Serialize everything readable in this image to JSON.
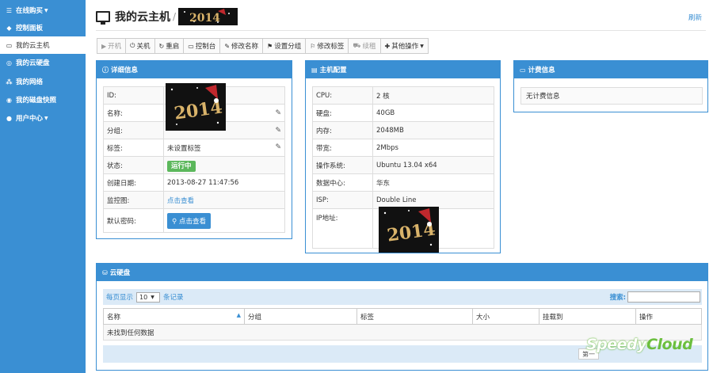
{
  "sidebar": {
    "items": [
      {
        "icon": "cart-icon",
        "glyph": "☰",
        "label": "在线购买",
        "dropdown": true
      },
      {
        "icon": "dashboard-icon",
        "glyph": "◆",
        "label": "控制面板"
      },
      {
        "icon": "monitor-icon",
        "glyph": "▭",
        "label": "我的云主机",
        "active": true
      },
      {
        "icon": "disk-icon",
        "glyph": "◎",
        "label": "我的云硬盘"
      },
      {
        "icon": "network-icon",
        "glyph": "⁂",
        "label": "我的网络"
      },
      {
        "icon": "snapshot-icon",
        "glyph": "◉",
        "label": "我的磁盘快照"
      },
      {
        "icon": "user-icon",
        "glyph": "●",
        "label": "用户中心",
        "dropdown": true
      }
    ]
  },
  "header": {
    "title": "我的云主机",
    "refresh_label": "刷新"
  },
  "toolbar": {
    "buttons": [
      {
        "icon": "play-icon",
        "glyph": "▶",
        "label": "开机",
        "disabled": true
      },
      {
        "icon": "power-icon",
        "glyph": "⏻",
        "label": "关机"
      },
      {
        "icon": "restart-icon",
        "glyph": "↻",
        "label": "重启"
      },
      {
        "icon": "console-icon",
        "glyph": "▭",
        "label": "控制台"
      },
      {
        "icon": "edit-icon",
        "glyph": "✎",
        "label": "修改名称"
      },
      {
        "icon": "group-icon",
        "glyph": "⚑",
        "label": "设置分组"
      },
      {
        "icon": "tag-icon",
        "glyph": "⚐",
        "label": "修改标签"
      },
      {
        "icon": "cart-icon",
        "glyph": "⛟",
        "label": "续租",
        "disabled": true
      },
      {
        "icon": "wrench-icon",
        "glyph": "✚",
        "label": "其他操作",
        "dropdown": true
      }
    ]
  },
  "detail_panel": {
    "title": "详细信息",
    "rows": [
      {
        "key": "ID:",
        "value": ""
      },
      {
        "key": "名称:",
        "value": "",
        "editable": true
      },
      {
        "key": "分组:",
        "value": "",
        "editable": true
      },
      {
        "key": "标签:",
        "value": "未设置标签",
        "editable": true
      },
      {
        "key": "状态:",
        "value": "运行中",
        "type": "badge"
      },
      {
        "key": "创建日期:",
        "value": "2013-08-27 11:47:56"
      },
      {
        "key": "监控图:",
        "value": "点击查看",
        "type": "link"
      },
      {
        "key": "默认密码:",
        "value": "点击查看",
        "type": "button"
      }
    ]
  },
  "config_panel": {
    "title": "主机配置",
    "rows": [
      {
        "key": "CPU:",
        "value": "2 核"
      },
      {
        "key": "硬盘:",
        "value": "40GB"
      },
      {
        "key": "内存:",
        "value": "2048MB"
      },
      {
        "key": "带宽:",
        "value": "2Mbps"
      },
      {
        "key": "操作系统:",
        "value": "Ubuntu 13.04 x64"
      },
      {
        "key": "数据中心:",
        "value": "华东"
      },
      {
        "key": "ISP:",
        "value": "Double Line"
      },
      {
        "key": "IP地址:",
        "value": ""
      }
    ]
  },
  "billing_panel": {
    "title": "计费信息",
    "empty_text": "无计费信息"
  },
  "disk_panel": {
    "title": "云硬盘",
    "per_page_prefix": "每页显示",
    "per_page_value": "10",
    "per_page_suffix": "条记录",
    "search_label": "搜索:",
    "columns": [
      "名称",
      "分组",
      "标签",
      "大小",
      "挂载到",
      "操作"
    ],
    "empty_text": "未找到任何数据",
    "pager_first": "第一"
  },
  "watermark": {
    "part1": "Speedy",
    "part2": "Cloud"
  },
  "colors": {
    "primary": "#3a8fd3",
    "success": "#5cb85c",
    "light_row": "#dbeaf7"
  }
}
